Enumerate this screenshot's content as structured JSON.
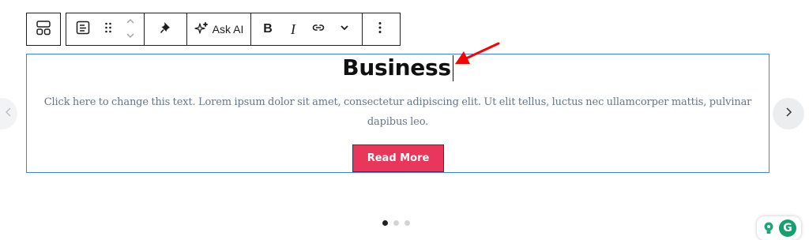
{
  "toolbar": {
    "ask_ai_label": "Ask AI",
    "bold_label": "B",
    "italic_label": "I"
  },
  "content": {
    "heading": "Business",
    "description": "Click here to change this text. Lorem ipsum dolor sit amet, consectetur adipiscing elit. Ut elit tellus, luctus nec ullamcorper mattis, pulvinar dapibus leo.",
    "button_label": "Read More"
  },
  "carousel": {
    "slide_count": 3,
    "active_slide": 1
  },
  "grammarly_badge": "G",
  "colors": {
    "accent_button": "#e8375a",
    "selection_outline": "#3b82f6",
    "annotation_arrow": "#ff0000"
  }
}
